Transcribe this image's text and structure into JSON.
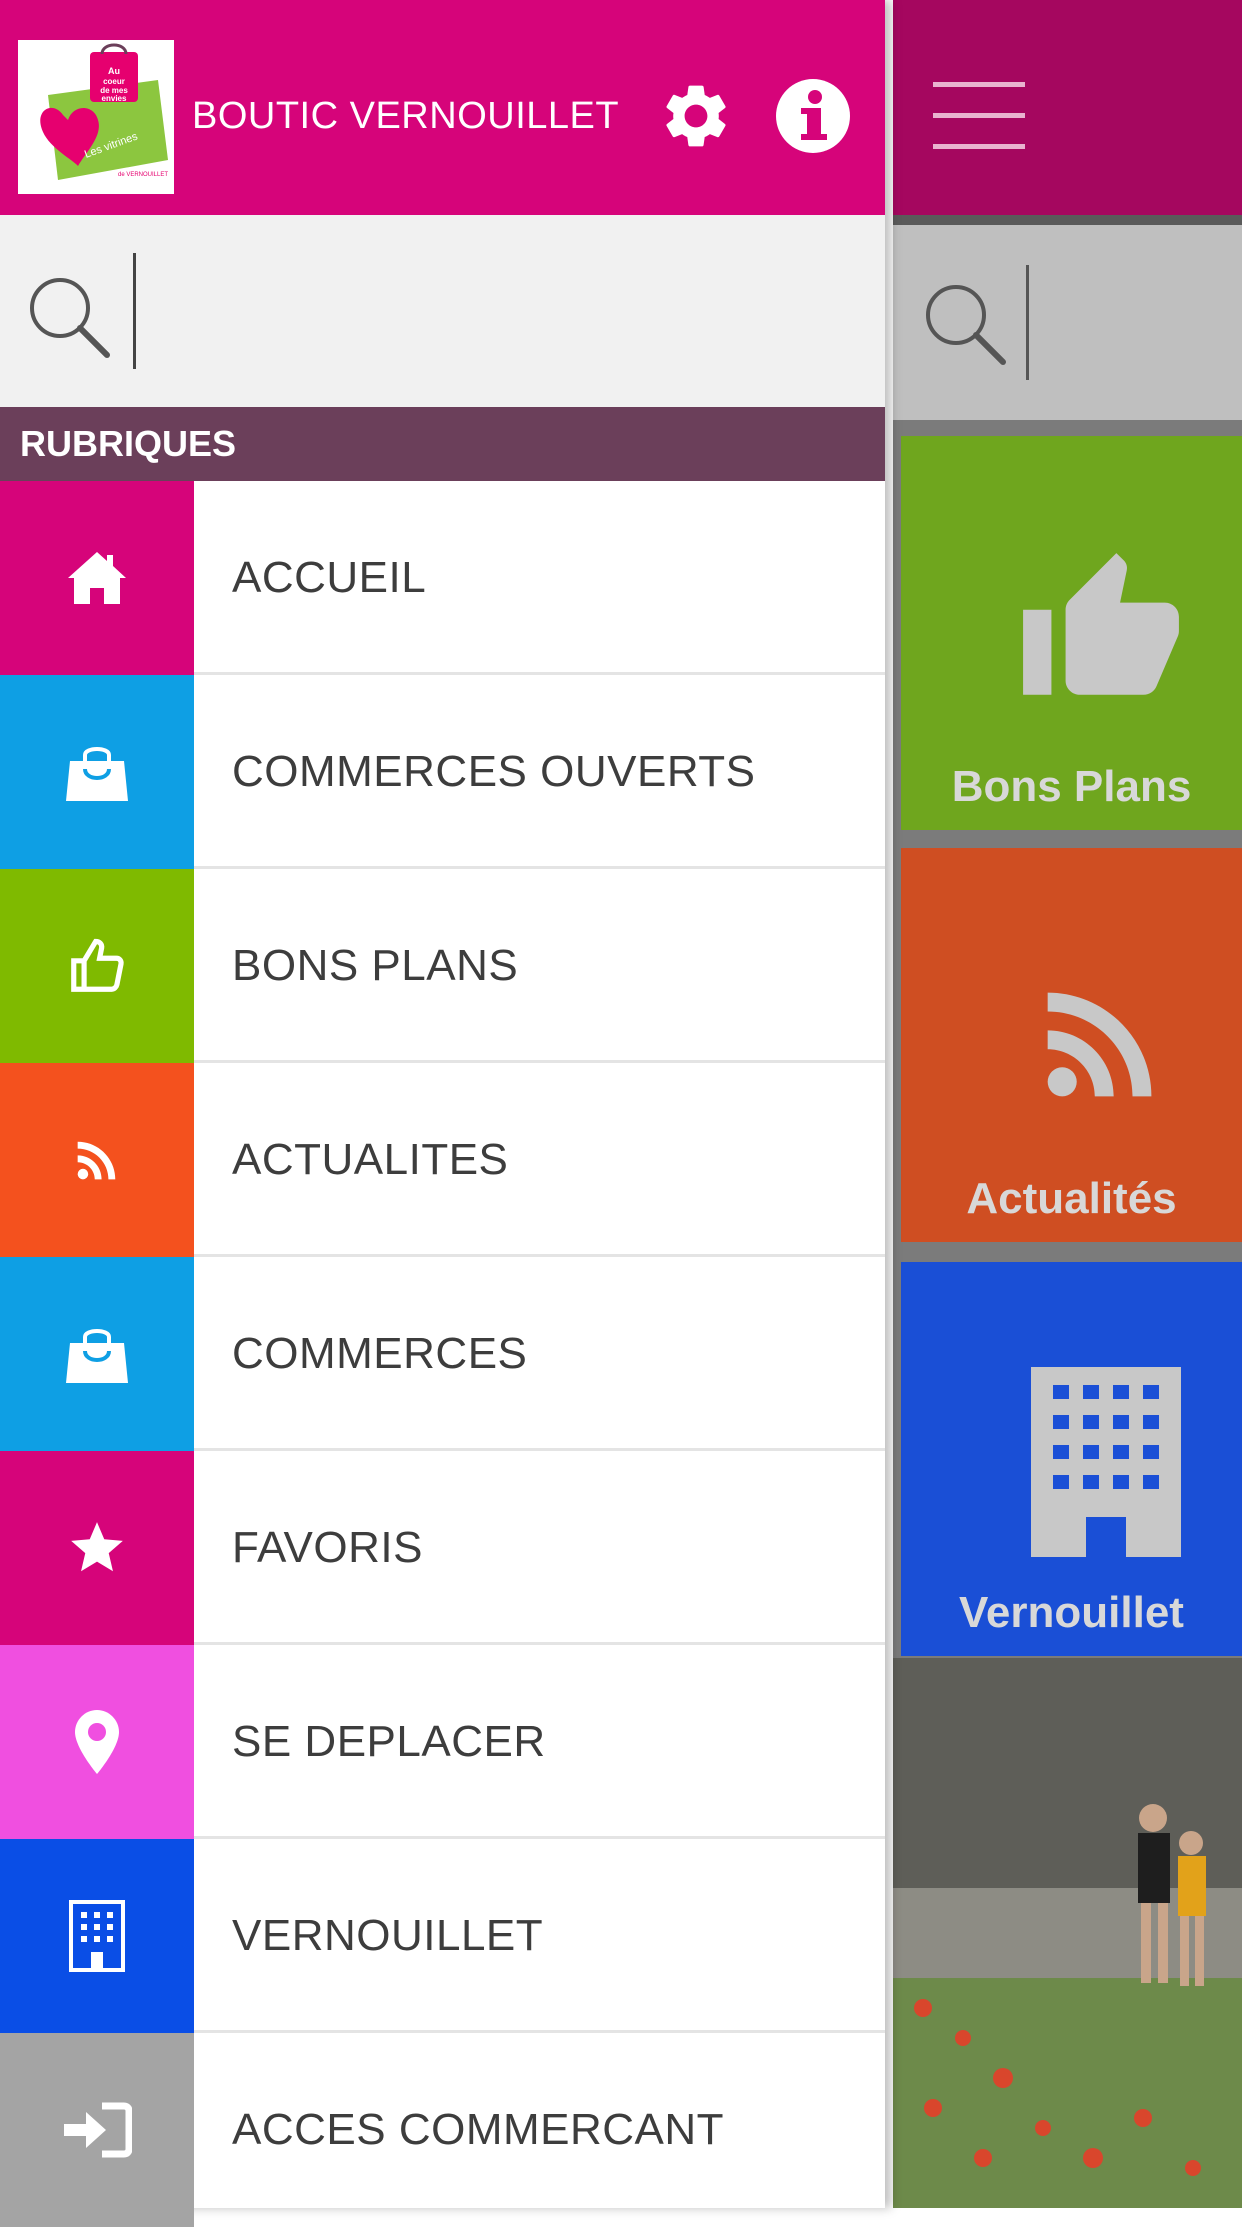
{
  "app": {
    "title": "BOUTIC VERNOUILLET",
    "logo_text": "Au coeur de mes envies · Les vitrines de VERNOUILLET",
    "brand_color": "#d6047a"
  },
  "search": {
    "placeholder": "",
    "value": ""
  },
  "section": {
    "title": "RUBRIQUES"
  },
  "menu": [
    {
      "label": "ACCUEIL",
      "icon": "home-icon",
      "color": "#d6047a"
    },
    {
      "label": "COMMERCES OUVERTS",
      "icon": "shopping-bag-icon",
      "color": "#0e9fe4"
    },
    {
      "label": "BONS PLANS",
      "icon": "thumbs-up-icon",
      "color": "#7fba00"
    },
    {
      "label": "ACTUALITES",
      "icon": "rss-icon",
      "color": "#f4511e"
    },
    {
      "label": "COMMERCES",
      "icon": "shopping-bag-icon",
      "color": "#0e9fe4"
    },
    {
      "label": "FAVORIS",
      "icon": "star-icon",
      "color": "#d6047a"
    },
    {
      "label": "SE DEPLACER",
      "icon": "map-pin-icon",
      "color": "#f04fe0"
    },
    {
      "label": "VERNOUILLET",
      "icon": "building-icon",
      "color": "#0a4ee6"
    },
    {
      "label": "ACCES COMMERCANT",
      "icon": "sign-in-icon",
      "color": "#a4a4a4"
    }
  ],
  "background_tiles": [
    {
      "label": "Bons Plans",
      "icon": "thumbs-up-icon",
      "color": "#7fba00"
    },
    {
      "label": "Actualités",
      "icon": "rss-icon",
      "color": "#e0521e"
    },
    {
      "label": "Vernouillet",
      "icon": "building-icon",
      "color": "#1a4fd6"
    }
  ]
}
